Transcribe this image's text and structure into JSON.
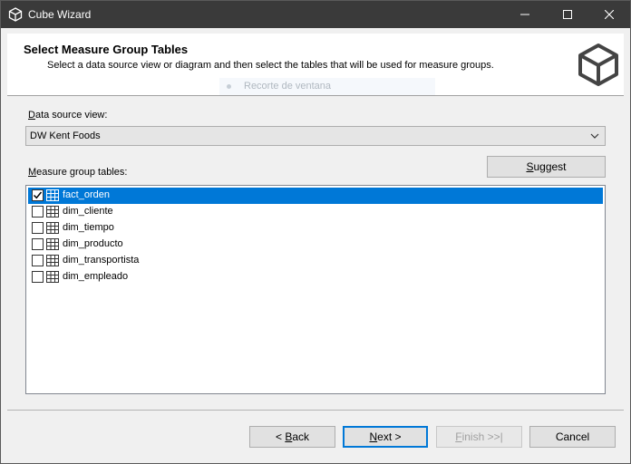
{
  "window": {
    "title": "Cube Wizard"
  },
  "header": {
    "title": "Select Measure Group Tables",
    "subtitle": "Select a data source view or diagram and then select the tables that will be used for measure groups.",
    "ghost_text": "Recorte de ventana"
  },
  "data_source": {
    "label_prefix": "D",
    "label_rest": "ata source view:",
    "value": "DW Kent Foods"
  },
  "measure_tables": {
    "label_prefix": "M",
    "label_rest": "easure group tables:",
    "suggest_prefix": "S",
    "suggest_rest": "uggest",
    "rows": [
      {
        "name": "fact_orden",
        "checked": true,
        "selected": true
      },
      {
        "name": "dim_cliente",
        "checked": false,
        "selected": false
      },
      {
        "name": "dim_tiempo",
        "checked": false,
        "selected": false
      },
      {
        "name": "dim_producto",
        "checked": false,
        "selected": false
      },
      {
        "name": "dim_transportista",
        "checked": false,
        "selected": false
      },
      {
        "name": "dim_empleado",
        "checked": false,
        "selected": false
      }
    ]
  },
  "footer": {
    "back_pre": "< ",
    "back_u": "B",
    "back_rest": "ack",
    "next_u": "N",
    "next_rest": "ext >",
    "finish_u": "F",
    "finish_rest": "inish >>|",
    "cancel": "Cancel"
  },
  "colors": {
    "selection": "#0078d7",
    "titlebar": "#3a3a3a"
  }
}
